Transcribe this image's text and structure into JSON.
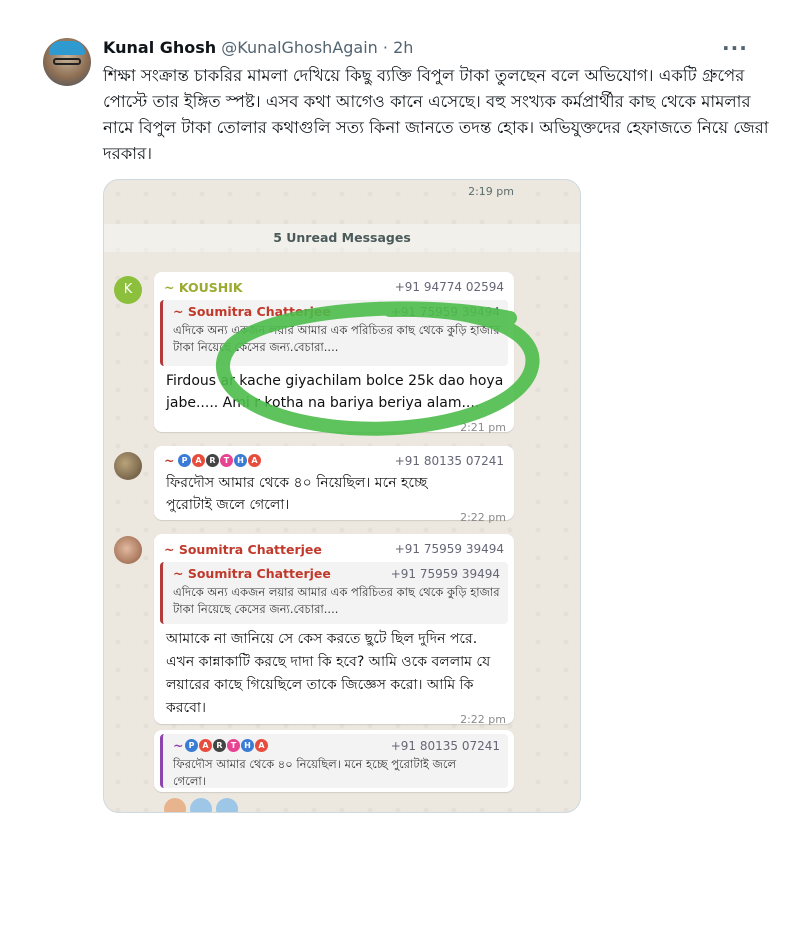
{
  "tweet": {
    "author_name": "Kunal Ghosh",
    "handle": "@KunalGhoshAgain",
    "separator": "·",
    "time_ago": "2h",
    "more_icon": "more-horizontal-icon",
    "text": "শিক্ষা সংক্রান্ত চাকরির মামলা দেখিয়ে কিছু ব্যক্তি বিপুল টাকা তুলছেন বলে অভিযোগ। একটি গ্রুপের পোস্টে তার ইঙ্গিত স্পষ্ট। এসব কথা আগেও কানে এসেছে। বহু সংখ্যক কর্মপ্রার্থীর কাছ থেকে মামলার নামে বিপুল টাকা তোলার কথাগুলি সত্য কিনা জানতে তদন্ত হোক। অভিযুক্তদের হেফাজতে নিয়ে জেরা দরকার।"
  },
  "chat": {
    "top_time": "2:19 pm",
    "unread_label": "5 Unread Messages",
    "messages": [
      {
        "avatar_letter": "K",
        "sender": "~ KOUSHIK",
        "sender_color": "#9aab2f",
        "phone": "+91 94774 02594",
        "quote_name": "~ Soumitra Chatterjee",
        "quote_phone": "+91 75959 39494",
        "quote_text": "এদিকে অন্য একজন লয়ার আমার এক পরিচিতর কাছ থেকে কুড়ি হাজার টাকা নিয়েছে কেসের জন্য.বেচারা....",
        "text": "Firdous ar kache giyachilam bolce 25k dao hoya jabe..... Ami r kotha na bariya beriya alam....",
        "time": "2:21 pm"
      },
      {
        "sender_prefix": "~",
        "sender_badges": [
          "P",
          "A",
          "R",
          "T",
          "H",
          "A"
        ],
        "phone": "+91 80135 07241",
        "text": "ফিরদৌস আমার থেকে ৪০ নিয়েছিল। মনে হচ্ছে পুরোটাই জলে গেলো।",
        "time": "2:22 pm"
      },
      {
        "sender": "~ Soumitra Chatterjee",
        "sender_color": "#c0392b",
        "phone": "+91 75959 39494",
        "quote_name": "~ Soumitra Chatterjee",
        "quote_phone": "+91 75959 39494",
        "quote_text": "এদিকে অন্য একজন লয়ার আমার এক পরিচিতর কাছ থেকে কুড়ি হাজার টাকা নিয়েছে কেসের জন্য.বেচারা....",
        "text": "আমাকে না জানিয়ে সে কেস করতে ছুটে ছিল দুদিন পরে. এখন কান্নাকাটি করছে দাদা কি হবে? আমি ওকে বললাম যে লয়ারের কাছে গিয়েছিলে  তাকে জিজ্ঞেস করো। আমি কি করবো।",
        "time": "2:22 pm"
      },
      {
        "sender_prefix": "~",
        "sender_badges": [
          "P",
          "A",
          "R",
          "T",
          "H",
          "A"
        ],
        "phone": "+91 80135 07241",
        "text": "ফিরদৌস আমার থেকে ৪০ নিয়েছিল। মনে হচ্ছে পুরোটাই জলে গেলো।"
      }
    ],
    "highlight_color": "#4cbc4a"
  }
}
